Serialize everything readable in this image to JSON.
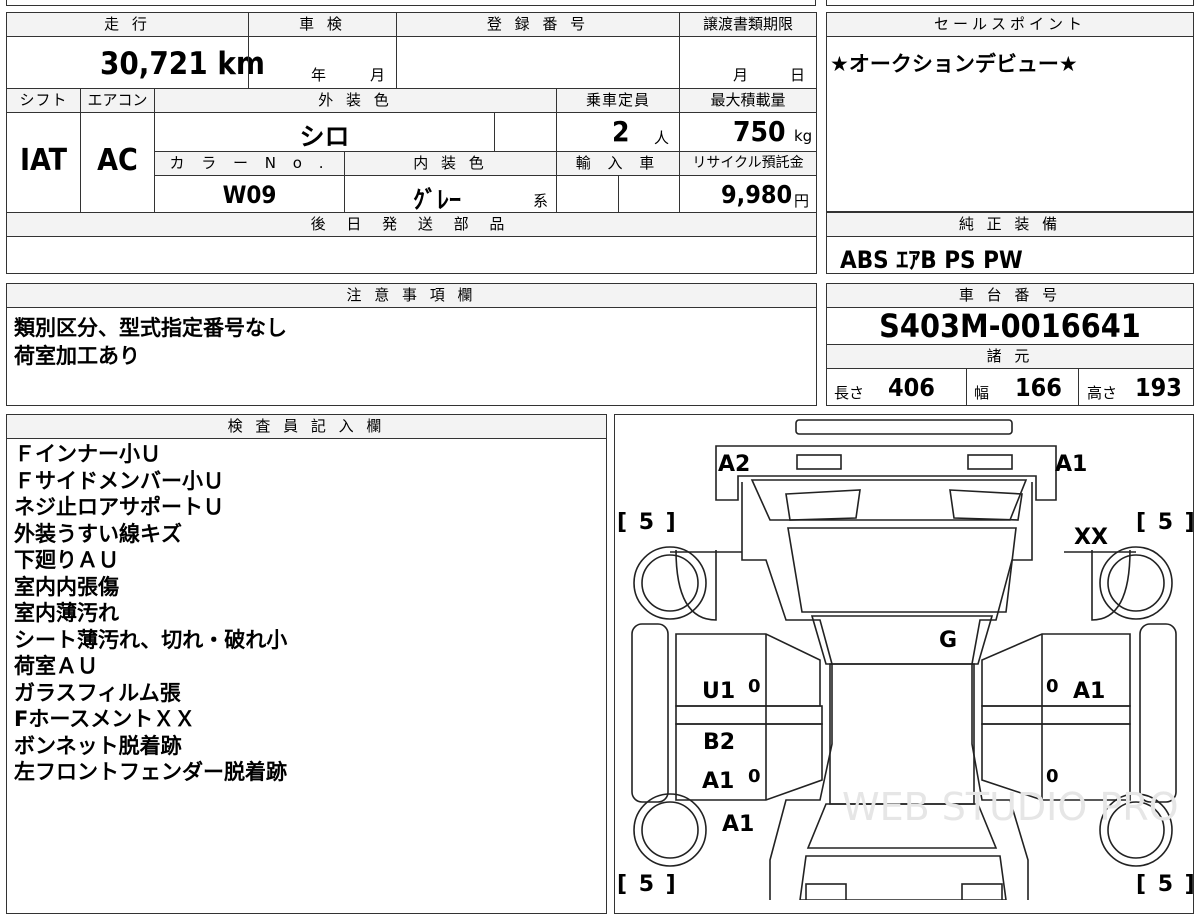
{
  "mileage": {
    "header": "走 行",
    "value": "30,721",
    "unit": "km"
  },
  "inspection": {
    "header": "車 検",
    "year_unit": "年",
    "month_unit": "月"
  },
  "registration": {
    "header": "登 録 番 号"
  },
  "transfer": {
    "header": "譲渡書類期限",
    "month_unit": "月",
    "day_unit": "日"
  },
  "sales_point": {
    "header": "セールスポイント",
    "text": "★オークションデビュー★"
  },
  "shift": {
    "header": "シフト",
    "value": "IAT"
  },
  "aircon": {
    "header": "エアコン",
    "value": "AC"
  },
  "exterior": {
    "header": "外 装 色",
    "value": "シロ"
  },
  "capacity": {
    "header": "乗車定員",
    "value": "2",
    "unit": "人"
  },
  "max_load": {
    "header": "最大積載量",
    "value": "750",
    "unit": "kg"
  },
  "color_no": {
    "header": "カ ラ ー N o .",
    "value": "W09"
  },
  "interior": {
    "header": "内 装 色",
    "value": "ｸﾞﾚｰ",
    "suffix": "系"
  },
  "import": {
    "header": "輸 入 車"
  },
  "recycle": {
    "header": "リサイクル預託金",
    "value": "9,980",
    "unit": "円"
  },
  "later_parts": {
    "header": "後 日 発 送 部 品"
  },
  "equipment": {
    "header": "純 正 装 備",
    "value": "ABS ｴｱB PS PW"
  },
  "notes": {
    "header": "注 意 事 項 欄",
    "lines": [
      "類別区分、型式指定番号なし",
      "荷室加工あり"
    ]
  },
  "chassis": {
    "header": "車 台 番 号",
    "value": "S403M-0016641"
  },
  "specs": {
    "header": "諸 元",
    "length_label": "長さ",
    "length": "406",
    "width_label": "幅",
    "width": "166",
    "height_label": "高さ",
    "height": "193"
  },
  "inspector": {
    "header": "検 査 員 記 入 欄",
    "lines": [
      "Ｆインナー小Ｕ",
      "Ｆサイドメンバー小Ｕ",
      "ネジ止ロアサポートＵ",
      "外装うすい線キズ",
      "下廻りＡＵ",
      "室内内張傷",
      "室内薄汚れ",
      "シート薄汚れ、切れ・破れ小",
      "荷室ＡＵ",
      "ガラスフィルム張",
      "FホースメントＸＸ",
      "ボンネット脱着跡",
      "左フロントフェンダー脱着跡"
    ]
  },
  "diagram": {
    "tire_fl": "[ 5 ]",
    "tire_fr": "[ 5 ]",
    "tire_rl": "[ 5 ]",
    "tire_rr": "[ 5 ]",
    "a2": "A2",
    "a1_top": "A1",
    "xx": "XX",
    "g": "G",
    "u1": "U1",
    "a1_right": "A1",
    "b2": "B2",
    "a1_left": "A1",
    "a1_low": "A1",
    "zero1": "0",
    "zero2": "0",
    "zero3": "0",
    "zero4": "0",
    "watermark": "WEB STUDIO PRO"
  }
}
